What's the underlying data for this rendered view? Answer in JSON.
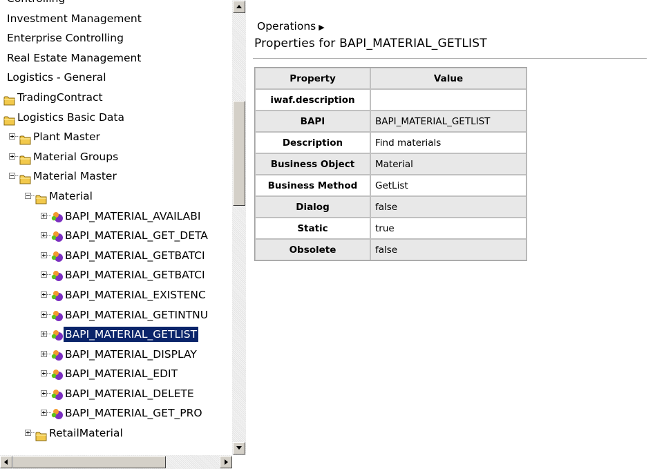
{
  "tree": {
    "items": [
      {
        "label": "Controlling",
        "kind": "text",
        "indent": 0
      },
      {
        "label": "Investment Management",
        "kind": "text",
        "indent": 0
      },
      {
        "label": "Enterprise Controlling",
        "kind": "text",
        "indent": 0
      },
      {
        "label": "Real Estate Management",
        "kind": "text",
        "indent": 0
      },
      {
        "label": "Logistics - General",
        "kind": "text",
        "indent": 0
      },
      {
        "label": "TradingContract",
        "kind": "folder",
        "indent": 0
      },
      {
        "label": "Logistics Basic Data",
        "kind": "folder",
        "indent": 0
      },
      {
        "label": "Plant Master",
        "kind": "folder",
        "indent": 1,
        "expander": "plus"
      },
      {
        "label": "Material Groups",
        "kind": "folder",
        "indent": 1,
        "expander": "plus"
      },
      {
        "label": "Material Master",
        "kind": "folder",
        "indent": 1,
        "expander": "minus"
      },
      {
        "label": "Material",
        "kind": "folder",
        "indent": 2,
        "expander": "minus"
      },
      {
        "label": "BAPI_MATERIAL_AVAILABI",
        "kind": "bapi",
        "indent": 3,
        "expander": "plus"
      },
      {
        "label": "BAPI_MATERIAL_GET_DETA",
        "kind": "bapi",
        "indent": 3,
        "expander": "plus"
      },
      {
        "label": "BAPI_MATERIAL_GETBATCI",
        "kind": "bapi",
        "indent": 3,
        "expander": "plus"
      },
      {
        "label": "BAPI_MATERIAL_GETBATCI",
        "kind": "bapi",
        "indent": 3,
        "expander": "plus"
      },
      {
        "label": "BAPI_MATERIAL_EXISTENC",
        "kind": "bapi",
        "indent": 3,
        "expander": "plus"
      },
      {
        "label": "BAPI_MATERIAL_GETINTNU",
        "kind": "bapi",
        "indent": 3,
        "expander": "plus"
      },
      {
        "label": "BAPI_MATERIAL_GETLIST",
        "kind": "bapi",
        "indent": 3,
        "expander": "plus",
        "selected": true
      },
      {
        "label": "BAPI_MATERIAL_DISPLAY",
        "kind": "bapi",
        "indent": 3,
        "expander": "plus"
      },
      {
        "label": "BAPI_MATERIAL_EDIT",
        "kind": "bapi",
        "indent": 3,
        "expander": "plus"
      },
      {
        "label": "BAPI_MATERIAL_DELETE",
        "kind": "bapi",
        "indent": 3,
        "expander": "plus"
      },
      {
        "label": "BAPI_MATERIAL_GET_PRO",
        "kind": "bapi",
        "indent": 3,
        "expander": "plus"
      },
      {
        "label": "RetailMaterial",
        "kind": "folder",
        "indent": 2,
        "expander": "plus"
      }
    ]
  },
  "content": {
    "breadcrumb": "Operations",
    "breadcrumb_arrow": "▶",
    "title": "Properties for BAPI_MATERIAL_GETLIST",
    "table": {
      "headers": [
        "Property",
        "Value"
      ],
      "rows": [
        {
          "key": "iwaf.description",
          "value": ""
        },
        {
          "key": "BAPI",
          "value": "BAPI_MATERIAL_GETLIST"
        },
        {
          "key": "Description",
          "value": "Find materials"
        },
        {
          "key": "Business Object",
          "value": "Material"
        },
        {
          "key": "Business Method",
          "value": "GetList"
        },
        {
          "key": "Dialog",
          "value": "false"
        },
        {
          "key": "Static",
          "value": "true"
        },
        {
          "key": "Obsolete",
          "value": "false"
        }
      ]
    }
  },
  "colors": {
    "selection": "#0a246a",
    "folder": "#f2c94c",
    "bapi_purple": "#7b2fc0",
    "bapi_orange": "#f39a2e",
    "bapi_green": "#5dc21e",
    "table_shade": "#e8e8e8"
  },
  "icons": {
    "folder": "folder-icon",
    "bapi": "bapi-method-icon",
    "expand": "expand-plus-icon",
    "collapse": "collapse-minus-icon"
  }
}
